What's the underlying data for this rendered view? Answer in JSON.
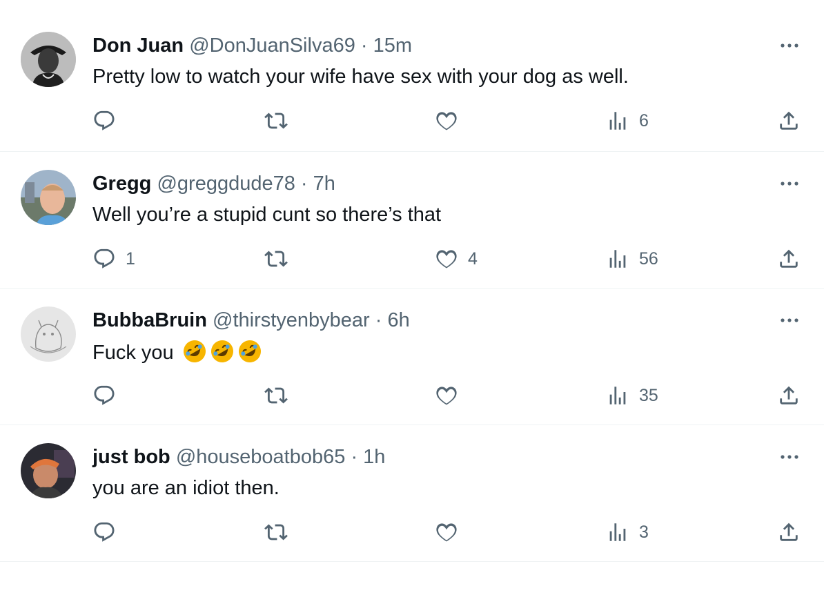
{
  "icons": {
    "reply": "reply-icon",
    "retweet": "retweet-icon",
    "like": "heart-icon",
    "views": "views-icon",
    "share": "share-icon",
    "more": "more-icon"
  },
  "colors": {
    "text_primary": "#0f1419",
    "text_secondary": "#536471",
    "divider": "#eff3f4",
    "emoji_yellow": "#f7b500"
  },
  "tweets": [
    {
      "name": "Don Juan",
      "handle": "@DonJuanSilva69",
      "dot": "·",
      "time": "15m",
      "text": "Pretty low to watch your wife have sex with your dog as well.",
      "reply_count": "",
      "retweet_count": "",
      "like_count": "",
      "view_count": "6"
    },
    {
      "name": "Gregg",
      "handle": "@greggdude78",
      "dot": "·",
      "time": "7h",
      "text": "Well you’re a stupid cunt so there’s that",
      "reply_count": "1",
      "retweet_count": "",
      "like_count": "4",
      "view_count": "56"
    },
    {
      "name": "BubbaBruin",
      "handle": "@thirstyenbybear",
      "dot": "·",
      "time": "6h",
      "text": "Fuck you",
      "emoji": "rolling-on-floor-laughing",
      "reply_count": "",
      "retweet_count": "",
      "like_count": "",
      "view_count": "35"
    },
    {
      "name": "just bob",
      "handle": "@houseboatbob65",
      "dot": "·",
      "time": "1h",
      "text": "you are an idiot then.",
      "reply_count": "",
      "retweet_count": "",
      "like_count": "",
      "view_count": "3"
    }
  ]
}
